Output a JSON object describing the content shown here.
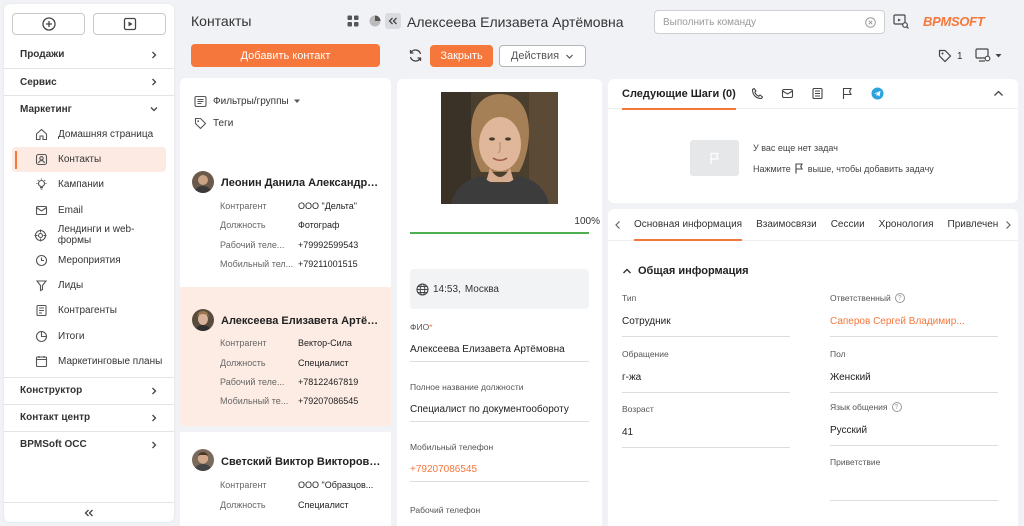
{
  "nav": {
    "groups": {
      "sales": "Продажи",
      "service": "Сервис",
      "marketing": "Маркетинг",
      "constructor": "Конструктор",
      "contact_center": "Контакт центр",
      "occ": "BPMSoft OCC"
    },
    "items": [
      {
        "label": "Домашняя страница",
        "icon": "home-icon"
      },
      {
        "label": "Контакты",
        "icon": "contact-icon"
      },
      {
        "label": "Кампании",
        "icon": "campaign-icon"
      },
      {
        "label": "Email",
        "icon": "email-icon"
      },
      {
        "label": "Лендинги и web-формы",
        "icon": "landing-icon"
      },
      {
        "label": "Мероприятия",
        "icon": "event-icon"
      },
      {
        "label": "Лиды",
        "icon": "leads-icon"
      },
      {
        "label": "Контрагенты",
        "icon": "accounts-icon"
      },
      {
        "label": "Итоги",
        "icon": "analytics-icon"
      },
      {
        "label": "Маркетинговые планы",
        "icon": "plans-icon"
      }
    ]
  },
  "list": {
    "title": "Контакты",
    "add_label": "Добавить контакт",
    "filters_label": "Фильтры/группы",
    "tags_label": "Теги",
    "cards": [
      {
        "name": "Леонин Данила Александро...",
        "rows": [
          {
            "k": "Контрагент",
            "v": "ООО \"Дельта\""
          },
          {
            "k": "Должность",
            "v": "Фотограф"
          },
          {
            "k": "Рабочий теле...",
            "v": "+79992599543"
          },
          {
            "k": "Мобильный тел...",
            "v": "+79211001515"
          }
        ]
      },
      {
        "name": "Алексеева Елизавета Артём...",
        "rows": [
          {
            "k": "Контрагент",
            "v": "Вектор-Сила"
          },
          {
            "k": "Должность",
            "v": "Специалист"
          },
          {
            "k": "Рабочий теле...",
            "v": "+78122467819"
          },
          {
            "k": "Мобильный те...",
            "v": "+79207086545"
          }
        ]
      },
      {
        "name": "Светский Виктор Викторович",
        "rows": [
          {
            "k": "Контрагент",
            "v": "ООО \"Образцов..."
          },
          {
            "k": "Должность",
            "v": "Специалист"
          }
        ]
      }
    ]
  },
  "header": {
    "title": "Алексеева Елизавета Артёмовна",
    "command_placeholder": "Выполнить команду",
    "logo": "BPMSOFT",
    "close_label": "Закрыть",
    "actions_label": "Действия",
    "tag_count": "1"
  },
  "profile": {
    "progress_label": "100%",
    "progress_value": 1.0,
    "time": "14:53,",
    "city": "Москва",
    "fields": [
      {
        "label": "ФИО",
        "required": "*",
        "value": "Алексеева Елизавета Артёмовна"
      },
      {
        "label": "Полное название должности",
        "value": "Специалист по документообороту"
      },
      {
        "label": "Мобильный телефон",
        "value": "+79207086545"
      },
      {
        "label": "Рабочий телефон",
        "value": ""
      }
    ]
  },
  "steps": {
    "title": "Следующие Шаги (0)",
    "empty_text": "У вас еще нет задач",
    "hint_before": "Нажмите",
    "hint_after": "выше, чтобы добавить задачу"
  },
  "details": {
    "tabs": [
      "Основная информация",
      "Взаимосвязи",
      "Сессии",
      "Хронология",
      "Привлечение"
    ],
    "section_title": "Общая информация",
    "fields": {
      "type": {
        "label": "Тип",
        "value": "Сотрудник"
      },
      "owner": {
        "label": "Ответственный",
        "value": "Саперов Сергей Владимир..."
      },
      "salutation": {
        "label": "Обращение",
        "value": "г-жа"
      },
      "gender": {
        "label": "Пол",
        "value": "Женский"
      },
      "age": {
        "label": "Возраст",
        "value": "41"
      },
      "language": {
        "label": "Язык общения",
        "value": "Русский"
      },
      "greeting": {
        "label": "Приветствие",
        "value": ""
      }
    }
  },
  "colors": {
    "accent": "#f5773b",
    "progress": "#4caf50",
    "selected_row": "#fcece4"
  }
}
